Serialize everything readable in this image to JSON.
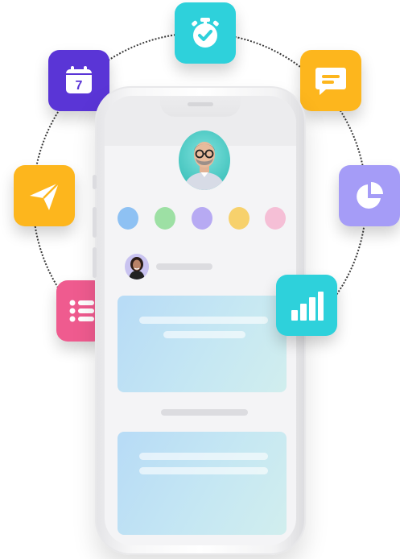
{
  "icons": {
    "timer": "stopwatch-check-icon",
    "calendar": "calendar-icon",
    "calendar_day": "7",
    "chat": "chat-bubble-icon",
    "send": "paper-plane-icon",
    "pie": "pie-chart-icon",
    "list": "list-icon",
    "bar": "bar-chart-icon"
  },
  "colors": {
    "teal": "#2ed1db",
    "purple": "#5a35d6",
    "yellow": "#fdb61d",
    "lavender": "#a59cf7",
    "pink": "#ef5b8f",
    "dot_blue": "#8ec1f3",
    "dot_green": "#9de0a4",
    "dot_purple": "#b7aaf3",
    "dot_yellow": "#f7d16c",
    "dot_pink": "#f5bfd6"
  }
}
